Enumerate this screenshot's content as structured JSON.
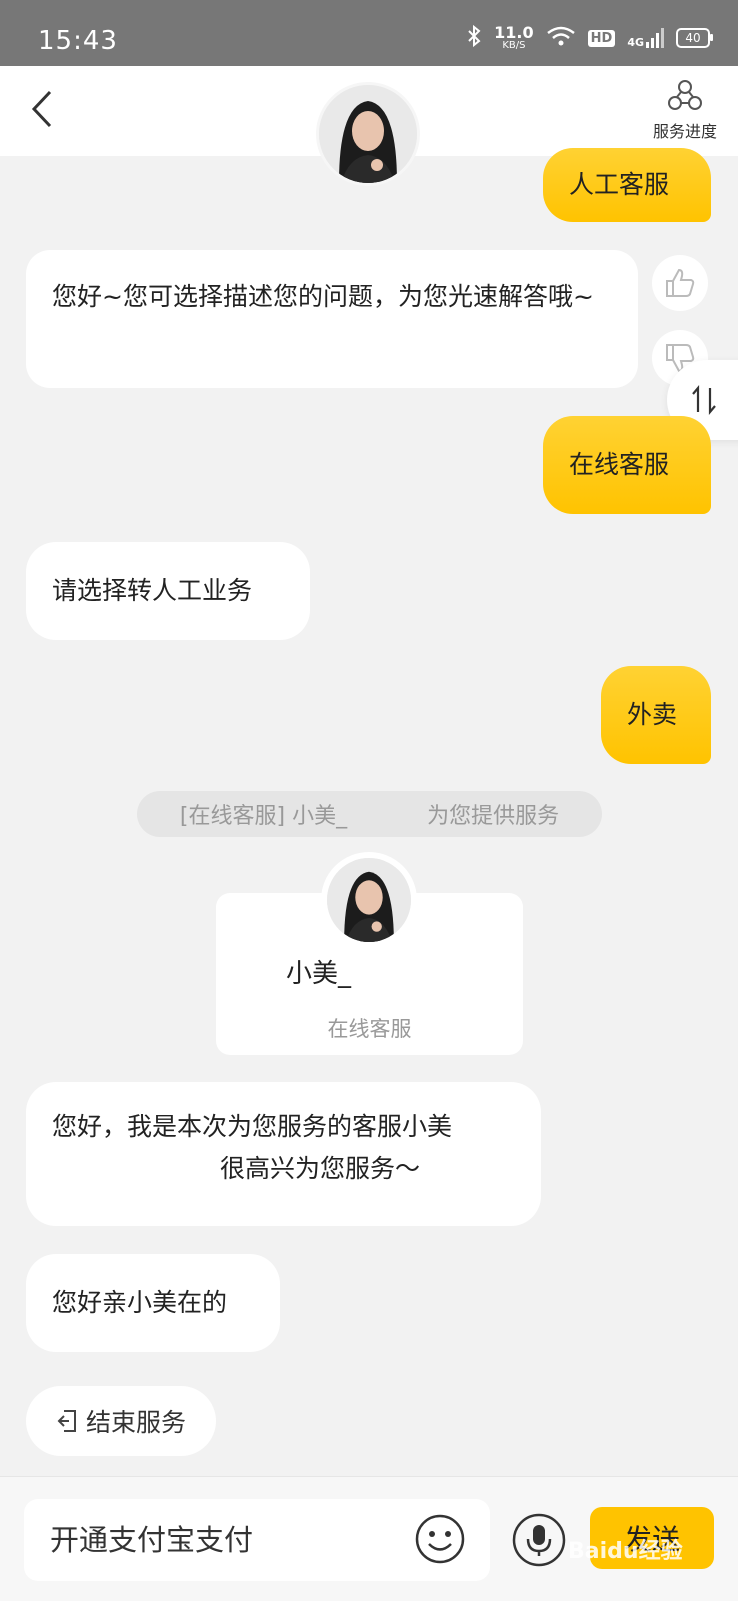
{
  "status_bar": {
    "time": "15:43",
    "net_speed_value": "11.0",
    "net_speed_unit": "KB/S",
    "hd_label": "HD",
    "signal_label": "4G",
    "battery_level": "40"
  },
  "header": {
    "service_progress_label": "服务进度"
  },
  "messages": {
    "out_1": "人工客服",
    "in_1": "您好~您可选择描述您的问题，为您光速解答哦~",
    "out_2": "在线客服",
    "in_2": "请选择转人工业务",
    "out_3": "外卖",
    "system_prefix": "[在线客服] 小美_",
    "system_suffix": "为您提供服务",
    "in_3_line1": "您好，我是本次为您服务的客服小美",
    "in_3_line2": "很高兴为您服务～",
    "in_4": "您好亲小美在的"
  },
  "agent_card": {
    "name": "小美_",
    "role": "在线客服"
  },
  "actions": {
    "end_service_label": "结束服务"
  },
  "composer": {
    "input_value": "开通支付宝支付",
    "send_label": "发送"
  },
  "watermark": {
    "text": "Baidu经验"
  },
  "colors": {
    "accent_yellow": "#ffc300",
    "background": "#f2f2f2",
    "status_bar": "#777777"
  }
}
